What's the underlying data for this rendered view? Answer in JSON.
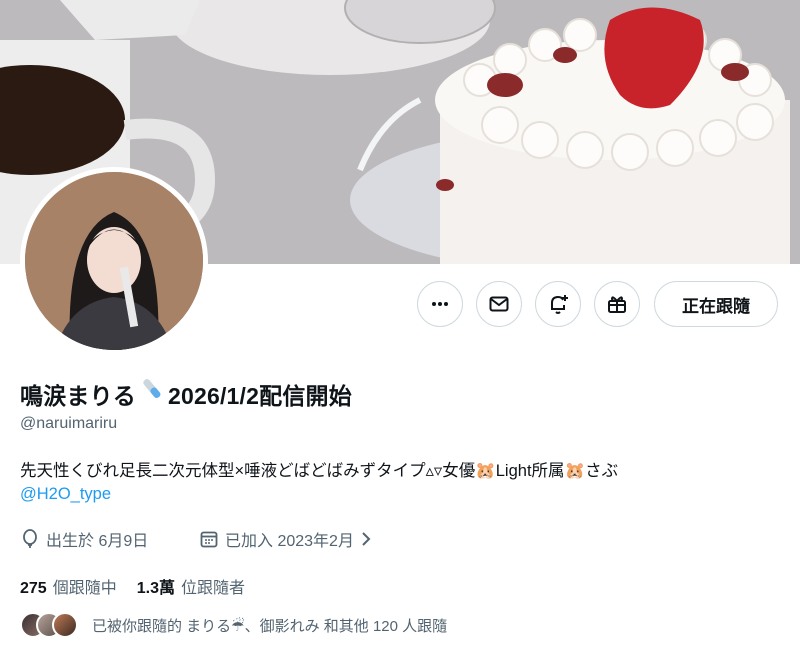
{
  "profile": {
    "display_name": "鳴涙まりる",
    "name_emoji": "test-tube-icon",
    "name_suffix": "2026/1/2配信開始",
    "handle": "@naruimariru",
    "bio_a": "先天性くびれ足長二次元体型×唾液どばどばみずタイプ▵▿女優",
    "bio_b": "Light所属",
    "bio_c": "さぶ",
    "bio_emoji": "hamster-icon",
    "bio_link": "@H2O_type",
    "birthday": "出生於 6月9日",
    "joined": "已加入 2023年2月",
    "following_count": "275",
    "following_label": "個跟隨中",
    "followers_count": "1.3萬",
    "followers_label": "位跟隨者",
    "followed_by_prefix": "已被你跟隨的 まりる",
    "followed_by_suffix": "、御影れみ 和其他 120 人跟隨",
    "followed_by_emoji": "umbrella-rain-icon"
  },
  "actions": {
    "more": "more-icon",
    "message": "mail-icon",
    "notify": "bell-plus-icon",
    "subscribe": "gift-icon",
    "follow_label": "正在跟隨"
  },
  "colors": {
    "link": "#1d9bf0",
    "secondary": "#536471",
    "border": "#cfd9de"
  }
}
